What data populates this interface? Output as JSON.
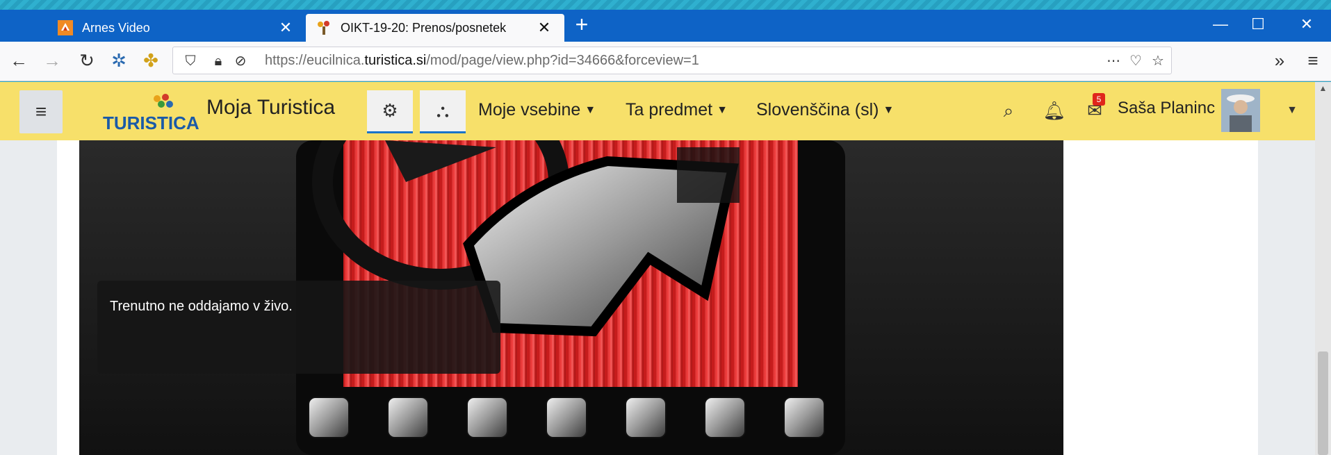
{
  "browser": {
    "tabs": [
      {
        "label": "Arnes Video",
        "active": false
      },
      {
        "label": "OIKT-19-20: Prenos/posnetek",
        "active": true
      }
    ],
    "url_prefix": "https://eucilnica.",
    "url_domain": "turistica.si",
    "url_path": "/mod/page/view.php?id=34666&forceview=1"
  },
  "site": {
    "name": "Moja Turistica",
    "logo_text": "TURISTICA",
    "menus": [
      "Moje vsebine",
      "Ta predmet",
      "Slovenščina (sl)"
    ],
    "notification_count": "5",
    "user_name": "Saša Planinc"
  },
  "video": {
    "status_message": "Trenutno ne oddajamo v živo."
  },
  "colors": {
    "tabbar": "#0e63c6",
    "header": "#f7e06a",
    "accent": "#1a73c9",
    "badge": "#e0261b"
  }
}
